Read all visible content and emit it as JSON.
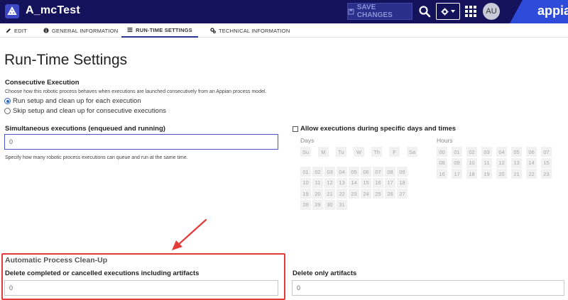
{
  "header": {
    "title": "A_mcTest",
    "save_label": "SAVE CHANGES",
    "avatar_initials": "AU",
    "brand": "appia",
    "colors": {
      "bar": "#15125c",
      "accent": "#2c3494",
      "highlight": "#e43a3a"
    }
  },
  "tabs": [
    {
      "label": "EDIT",
      "icon": "edit-icon"
    },
    {
      "label": "GENERAL INFORMATION",
      "icon": "info-icon"
    },
    {
      "label": "RUN-TIME SETTINGS",
      "icon": "list-icon",
      "active": true
    },
    {
      "label": "TECHNICAL INFORMATION",
      "icon": "cogs-icon"
    }
  ],
  "page": {
    "title": "Run-Time Settings"
  },
  "consecutive": {
    "heading": "Consecutive Execution",
    "description": "Choose how this robotic process behaves when executions are launched consecutively from an Appian process model.",
    "options": [
      {
        "label": "Run setup and clean up for each execution",
        "selected": true
      },
      {
        "label": "Skip setup and clean up for consecutive executions",
        "selected": false
      }
    ]
  },
  "simultaneous": {
    "heading": "Simultaneous executions (enqueued and running)",
    "value": "0",
    "help": "Specify how many robotic process executions can queue and run at the same time."
  },
  "schedule": {
    "checkbox_label": "Allow executions during specific days and times",
    "checked": false,
    "days_label": "Days",
    "hours_label": "Hours",
    "weekdays": [
      "Su",
      "M",
      "Tu",
      "W",
      "Th",
      "F",
      "Sa"
    ],
    "dates": [
      "01",
      "02",
      "03",
      "04",
      "05",
      "06",
      "07",
      "08",
      "09",
      "10",
      "11",
      "12",
      "13",
      "14",
      "15",
      "16",
      "17",
      "18",
      "19",
      "20",
      "21",
      "22",
      "23",
      "24",
      "25",
      "26",
      "27",
      "28",
      "29",
      "30",
      "31"
    ],
    "hours": [
      "00",
      "01",
      "02",
      "03",
      "04",
      "05",
      "06",
      "07",
      "08",
      "09",
      "10",
      "11",
      "12",
      "13",
      "14",
      "15",
      "16",
      "17",
      "18",
      "19",
      "20",
      "21",
      "22",
      "23"
    ]
  },
  "cleanup": {
    "heading": "Automatic Process Clean-Up",
    "completed_label": "Delete completed or cancelled executions including artifacts",
    "completed_value": "0",
    "artifacts_label": "Delete only artifacts",
    "artifacts_value": "0"
  }
}
